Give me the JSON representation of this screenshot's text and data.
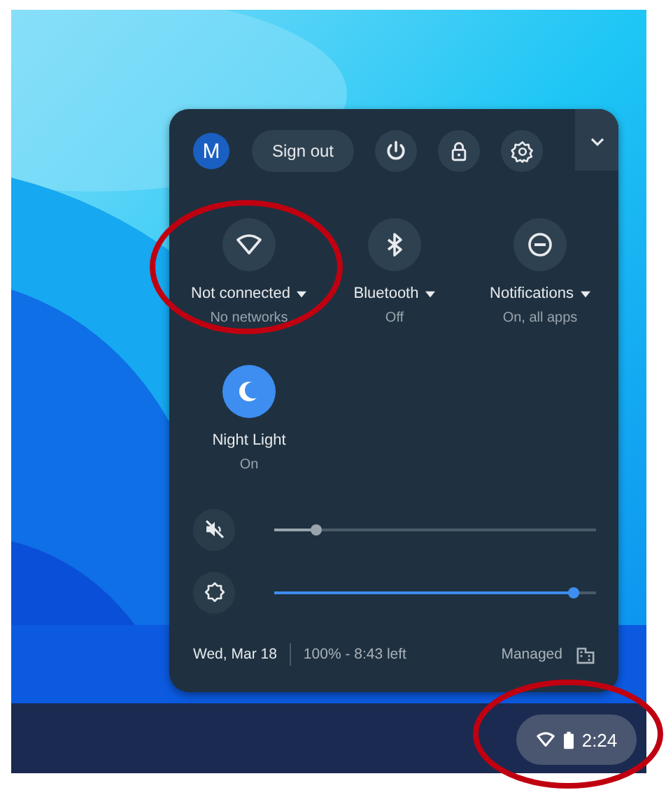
{
  "account": {
    "initial": "M"
  },
  "sign_out": "Sign out",
  "feature_pods": [
    {
      "kind": "network",
      "label": "Not connected",
      "sublabel": "No networks",
      "on": false,
      "has_menu": true
    },
    {
      "kind": "bluetooth",
      "label": "Bluetooth",
      "sublabel": "Off",
      "on": false,
      "has_menu": true
    },
    {
      "kind": "notifications",
      "label": "Notifications",
      "sublabel": "On, all apps",
      "on": false,
      "has_menu": true
    },
    {
      "kind": "night_light",
      "label": "Night Light",
      "sublabel": "On",
      "on": true,
      "has_menu": false
    }
  ],
  "sliders": [
    {
      "kind": "volume",
      "muted": true,
      "level": 0.13
    },
    {
      "kind": "brightness",
      "level": 0.93
    }
  ],
  "footer": {
    "date": "Wed, Mar 18",
    "battery": "100% - 8:43 left",
    "managed": "Managed"
  },
  "shelf": {
    "time": "2:24"
  }
}
